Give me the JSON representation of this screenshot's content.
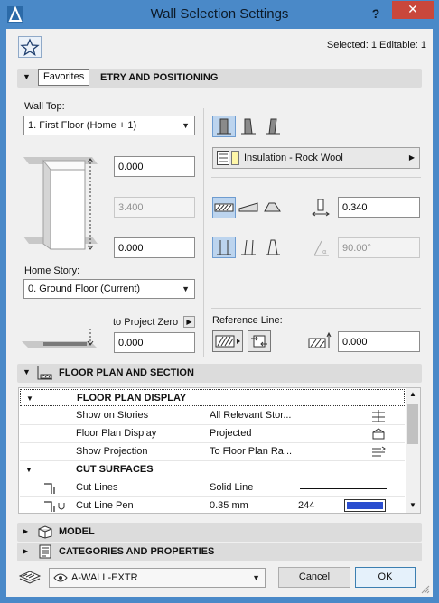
{
  "window": {
    "title": "Wall Selection Settings",
    "help": "?",
    "close": "✕"
  },
  "header": {
    "favorites_tooltip": "Favorites",
    "selected_info": "Selected: 1 Editable: 1"
  },
  "geometry": {
    "section_label": "ETRY AND POSITIONING",
    "wall_top_label": "Wall Top:",
    "wall_top_value": "1. First Floor (Home + 1)",
    "top_offset": "0.000",
    "height": "3.400",
    "bottom_offset": "0.000",
    "home_story_label": "Home Story:",
    "home_story_value": "0. Ground Floor (Current)",
    "project_zero_label": "to Project Zero",
    "project_zero_value": "0.000",
    "composite_label": "Insulation - Rock Wool",
    "thickness": "0.340",
    "angle": "90.00°",
    "reference_line_label": "Reference Line:",
    "reference_offset": "0.000"
  },
  "floor_plan": {
    "section_label": "FLOOR PLAN AND SECTION",
    "groups": [
      {
        "label": "FLOOR PLAN DISPLAY"
      },
      {
        "label": "CUT SURFACES"
      }
    ],
    "rows": [
      {
        "name": "Show on Stories",
        "value": "All Relevant Stor..."
      },
      {
        "name": "Floor Plan Display",
        "value": "Projected"
      },
      {
        "name": "Show Projection",
        "value": "To Floor Plan Ra..."
      },
      {
        "name": "Cut Lines",
        "value": "Solid Line"
      },
      {
        "name": "Cut Line Pen",
        "value": "0.35 mm",
        "extra": "244"
      }
    ],
    "pen_color": "#2b4ecf"
  },
  "model": {
    "section_label": "MODEL"
  },
  "categories": {
    "section_label": "CATEGORIES AND PROPERTIES"
  },
  "footer": {
    "layer_value": "A-WALL-EXTR",
    "cancel_label": "Cancel",
    "ok_label": "OK"
  }
}
